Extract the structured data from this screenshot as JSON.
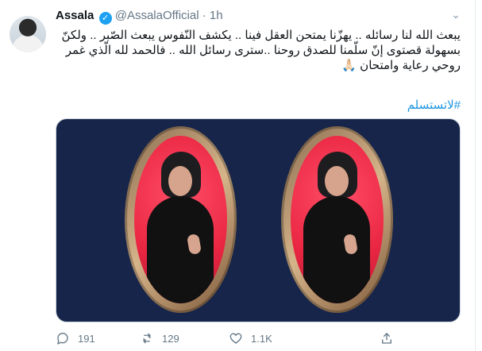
{
  "author": {
    "name": "Assala",
    "verified_icon": "✓",
    "handle": "@AssalaOfficial",
    "separator": "·",
    "time": "1h"
  },
  "menu_icon": "chevron-down-icon",
  "tweet": {
    "text": "يبعث الله لنا رسائله .. يهزّنا يمتحن العقل فينا .. يكشف النّفوس يبعث الصّبر .. ولكنّ بسهولة قصتوى إنّ سلّمنا للصدق روحنا ..سترى رسائل الله .. فالحمد لله الّذي غمر روحي رعاية وامتحان 🙏🏻",
    "hashtag": "#لاتستسلم"
  },
  "actions": {
    "reply_count": "191",
    "retweet_count": "129",
    "like_count": "1.1K"
  },
  "colors": {
    "link": "#1b95e0",
    "verified": "#1da1f2",
    "media_background": "#17254a",
    "portrait_background": "#ea2743"
  }
}
